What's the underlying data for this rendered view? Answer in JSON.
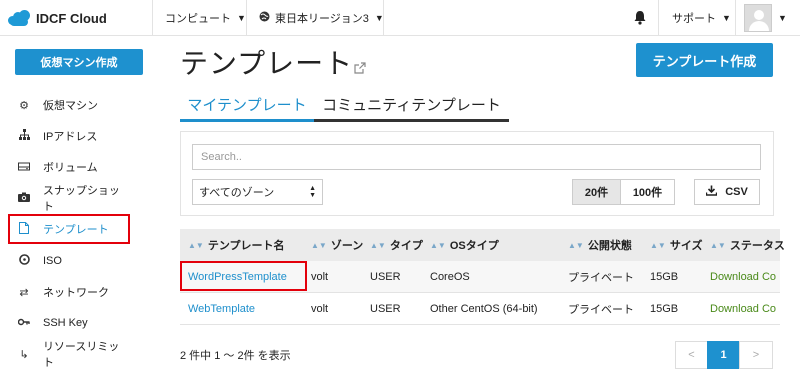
{
  "header": {
    "brand": "IDCF Cloud",
    "compute_menu": "コンピュート",
    "region_menu": "東日本リージョン3",
    "support_menu": "サポート",
    "icons": [
      "cloud-logo-icon",
      "chevron-down-icon",
      "globe-icon",
      "bell-icon",
      "avatar"
    ]
  },
  "sidebar": {
    "create_vm_label": "仮想マシン作成",
    "items": [
      {
        "label": "仮想マシン",
        "icon": "wrench-gear-icon"
      },
      {
        "label": "IPアドレス",
        "icon": "network-tree-icon"
      },
      {
        "label": "ボリューム",
        "icon": "drive-icon"
      },
      {
        "label": "スナップショット",
        "icon": "camera-icon"
      },
      {
        "label": "テンプレート",
        "icon": "document-icon",
        "active": true
      },
      {
        "label": "ISO",
        "icon": "disc-icon"
      },
      {
        "label": "ネットワーク",
        "icon": "shuffle-icon"
      },
      {
        "label": "SSH Key",
        "icon": "key-icon"
      },
      {
        "label": "リソースリミット",
        "icon": "level-up-icon"
      }
    ]
  },
  "main": {
    "title": "テンプレート",
    "create_button": "テンプレート作成",
    "tabs": [
      "マイテンプレート",
      "コミュニティテンプレート"
    ],
    "search_placeholder": "Search..",
    "zone_select": "すべてのゾーン",
    "page_size_20": "20件",
    "page_size_100": "100件",
    "csv_label": "CSV",
    "columns": [
      "テンプレート名",
      "ゾーン",
      "タイプ",
      "OSタイプ",
      "公開状態",
      "サイズ",
      "ステータス"
    ],
    "rows": [
      [
        "WordPressTemplate",
        "volt",
        "USER",
        "CoreOS",
        "プライベート",
        "15GB",
        "Download Co"
      ],
      [
        "WebTemplate",
        "volt",
        "USER",
        "Other CentOS (64-bit)",
        "プライベート",
        "15GB",
        "Download Co"
      ]
    ],
    "count_text": "2 件中 1 ～ 2件 を表示",
    "pagination": {
      "prev": "<",
      "current": "1",
      "next": ">"
    }
  },
  "colors": {
    "accent": "#1e91cf",
    "highlight": "#e3000b",
    "status_green": "#4a8a1a"
  }
}
